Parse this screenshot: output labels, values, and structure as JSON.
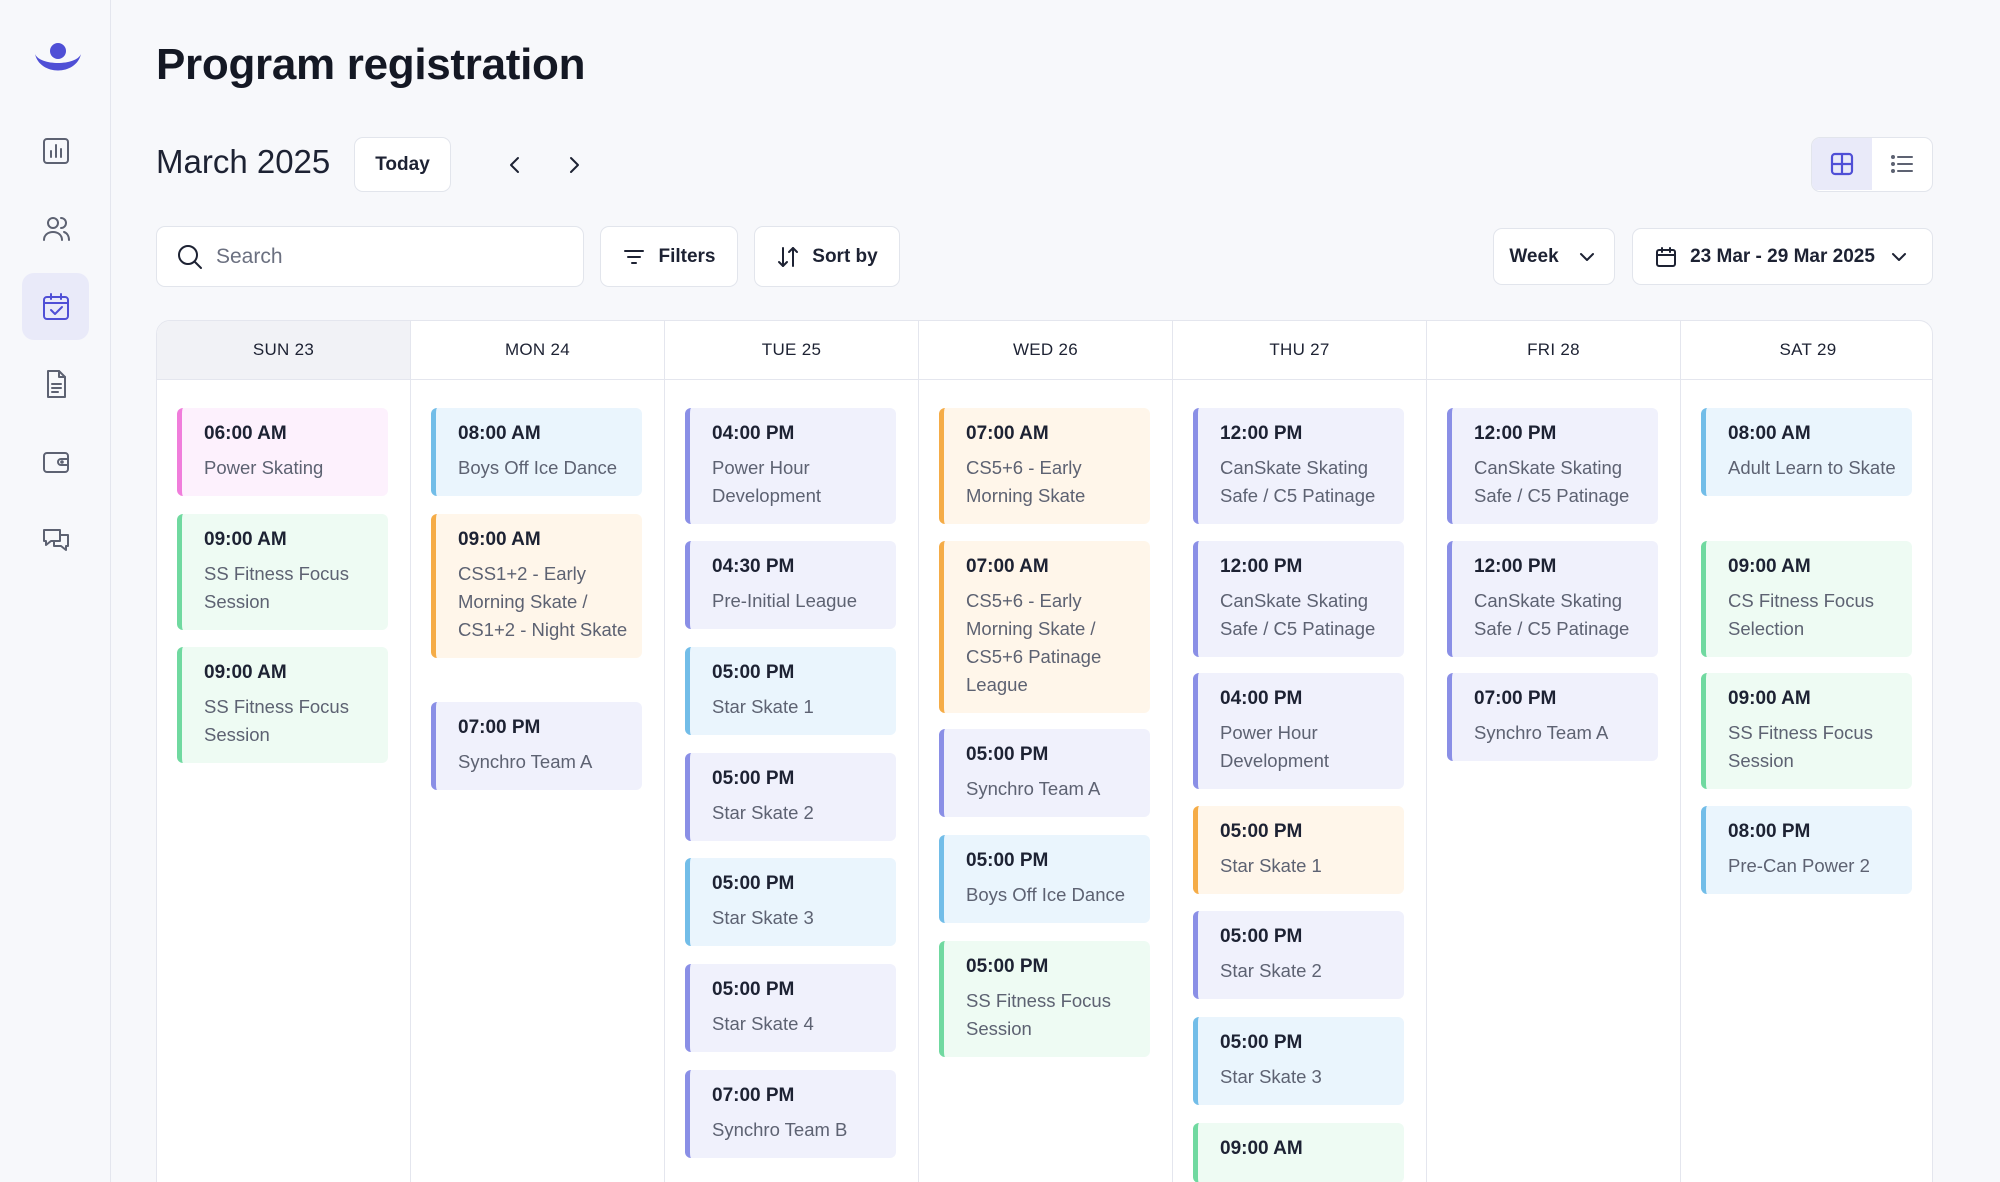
{
  "page": {
    "title": "Program registration"
  },
  "nav": {
    "items": [
      {
        "icon": "logo-icon"
      },
      {
        "icon": "chart-icon"
      },
      {
        "icon": "users-icon"
      },
      {
        "icon": "calendar-check-icon",
        "active": true
      },
      {
        "icon": "document-icon"
      },
      {
        "icon": "wallet-icon"
      },
      {
        "icon": "chat-icon"
      }
    ]
  },
  "toolbar": {
    "month": "March 2025",
    "today_label": "Today",
    "search_placeholder": "Search",
    "filters_label": "Filters",
    "sort_label": "Sort by",
    "view_label": "Week",
    "date_range": "23 Mar - 29 Mar 2025"
  },
  "colors": {
    "accent": "#4f4fd6",
    "pink": "#f07ddb",
    "green": "#70d9a0",
    "blue": "#72bde8",
    "orange": "#f5ac47",
    "purple": "#8a8fe6"
  },
  "days": [
    {
      "label": "SUN 23",
      "today": true,
      "events": [
        {
          "time": "06:00 AM",
          "name": "Power Skating",
          "color": "pink"
        },
        {
          "time": "09:00 AM",
          "name": "SS Fitness Focus Session",
          "color": "green"
        },
        {
          "time": "09:00 AM",
          "name": "SS Fitness Focus Session",
          "color": "green"
        }
      ]
    },
    {
      "label": "MON 24",
      "events": [
        {
          "time": "08:00 AM",
          "name": "Boys Off Ice Dance",
          "color": "blue"
        },
        {
          "time": "09:00 AM",
          "name": "CSS1+2 - Early Morning Skate / CS1+2 - Night Skate",
          "color": "orange"
        },
        {
          "time": "07:00 PM",
          "name": "Synchro Team A",
          "color": "purple"
        }
      ]
    },
    {
      "label": "TUE 25",
      "events": [
        {
          "time": "04:00 PM",
          "name": "Power Hour Development",
          "color": "purple"
        },
        {
          "time": "04:30 PM",
          "name": "Pre-Initial League",
          "color": "purple"
        },
        {
          "time": "05:00 PM",
          "name": "Star Skate 1",
          "color": "blue"
        },
        {
          "time": "05:00 PM",
          "name": "Star Skate 2",
          "color": "purple"
        },
        {
          "time": "05:00 PM",
          "name": "Star Skate 3",
          "color": "blue"
        },
        {
          "time": "05:00 PM",
          "name": "Star Skate 4",
          "color": "purple"
        },
        {
          "time": "07:00 PM",
          "name": "Synchro Team B",
          "color": "purple"
        }
      ]
    },
    {
      "label": "WED 26",
      "events": [
        {
          "time": "07:00 AM",
          "name": "CS5+6 - Early Morning Skate",
          "color": "orange"
        },
        {
          "time": "07:00 AM",
          "name": "CS5+6 - Early Morning Skate / CS5+6 Patinage League",
          "color": "orange"
        },
        {
          "time": "05:00 PM",
          "name": "Synchro Team A",
          "color": "purple"
        },
        {
          "time": "05:00 PM",
          "name": "Boys Off Ice Dance",
          "color": "blue"
        },
        {
          "time": "05:00 PM",
          "name": "SS Fitness Focus Session",
          "color": "green"
        }
      ]
    },
    {
      "label": "THU 27",
      "events": [
        {
          "time": "12:00 PM",
          "name": "CanSkate Skating Safe / C5 Patinage",
          "color": "purple"
        },
        {
          "time": "12:00 PM",
          "name": "CanSkate Skating Safe / C5 Patinage",
          "color": "purple"
        },
        {
          "time": "04:00 PM",
          "name": "Power Hour Development",
          "color": "purple"
        },
        {
          "time": "05:00 PM",
          "name": "Star Skate 1",
          "color": "orange"
        },
        {
          "time": "05:00 PM",
          "name": "Star Skate 2",
          "color": "purple"
        },
        {
          "time": "05:00 PM",
          "name": "Star Skate 3",
          "color": "blue"
        },
        {
          "time": "09:00 AM",
          "name": "",
          "color": "green"
        }
      ]
    },
    {
      "label": "FRI 28",
      "events": [
        {
          "time": "12:00 PM",
          "name": "CanSkate Skating Safe / C5 Patinage",
          "color": "purple"
        },
        {
          "time": "12:00 PM",
          "name": "CanSkate Skating Safe / C5 Patinage",
          "color": "purple"
        },
        {
          "time": "07:00 PM",
          "name": "Synchro Team A",
          "color": "purple"
        }
      ]
    },
    {
      "label": "SAT 29",
      "events": [
        {
          "time": "08:00 AM",
          "name": "Adult Learn to Skate",
          "color": "blue"
        },
        {
          "time": "09:00 AM",
          "name": "CS Fitness Focus Selection",
          "color": "green"
        },
        {
          "time": "09:00 AM",
          "name": "SS Fitness Focus Session",
          "color": "green"
        },
        {
          "time": "08:00 PM",
          "name": "Pre-Can Power 2",
          "color": "blue"
        }
      ]
    }
  ]
}
